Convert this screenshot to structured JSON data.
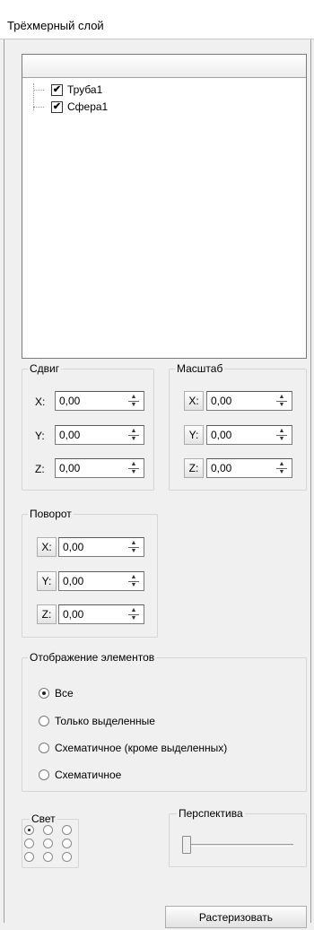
{
  "panel": {
    "title": "Трёхмерный слой"
  },
  "tree": {
    "items": [
      {
        "label": "Труба1",
        "checked": true
      },
      {
        "label": "Сфера1",
        "checked": true
      }
    ]
  },
  "shift": {
    "title": "Сдвиг",
    "x_label": "X:",
    "x_value": "0,00",
    "y_label": "Y:",
    "y_value": "0,00",
    "z_label": "Z:",
    "z_value": "0,00"
  },
  "scale": {
    "title": "Масштаб",
    "x_label": "X:",
    "x_value": "0,00",
    "y_label": "Y:",
    "y_value": "0,00",
    "z_label": "Z:",
    "z_value": "0,00"
  },
  "rotation": {
    "title": "Поворот",
    "x_label": "X:",
    "x_value": "0,00",
    "y_label": "Y:",
    "y_value": "0,00",
    "z_label": "Z:",
    "z_value": "0,00"
  },
  "display": {
    "title": "Отображение элементов",
    "options": [
      "Все",
      "Только выделенные",
      "Схематичное (кроме выделенных)",
      "Схематичное"
    ],
    "selected_index": 0
  },
  "light": {
    "title": "Свет",
    "selected": "top-left"
  },
  "perspective": {
    "title": "Перспектива",
    "level": 0
  },
  "rasterize_button": "Растеризовать"
}
